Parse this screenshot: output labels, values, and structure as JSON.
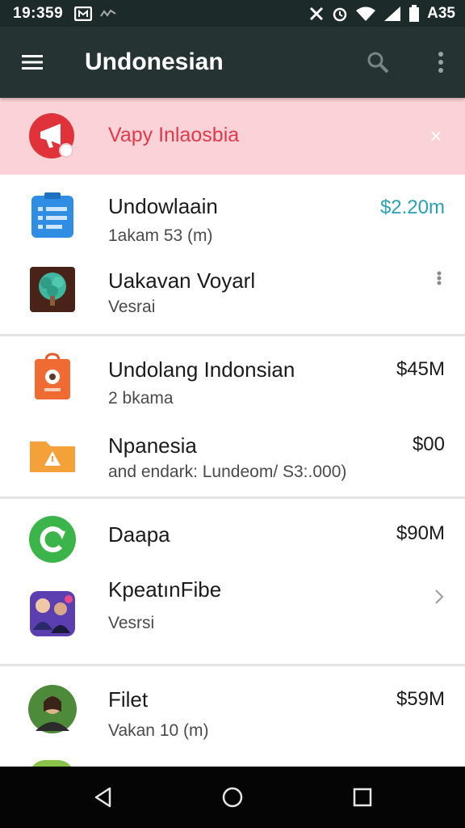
{
  "status_bar": {
    "time": "19:359",
    "battery_text": "A35"
  },
  "app_bar": {
    "title": "Undonesian"
  },
  "banner": {
    "text": "Vapy Inlaosbia",
    "close_glyph": "×"
  },
  "items": [
    {
      "title": "Undowlaain",
      "subtitle": "1akam 53 (m)",
      "amount": "$2.20m"
    },
    {
      "title": "Uakavan Voyarl",
      "subtitle": "Vesrai",
      "amount": ""
    },
    {
      "title": "Undolang Indonsian",
      "subtitle": "2 bkama",
      "amount": "$45M"
    },
    {
      "title": "Npanesia",
      "subtitle": "and endark: Lundeom/ S3:.000)",
      "amount": "$00"
    },
    {
      "title": "Daapa",
      "subtitle": "",
      "amount": "$90M"
    },
    {
      "title": "KpeatınFibe",
      "subtitle": "Vesrsi",
      "amount": ""
    },
    {
      "title": "Filet",
      "subtitle": "Vakan 10 (m)",
      "amount": "$59M"
    }
  ],
  "colors": {
    "status_bar": "#1d2a2a",
    "app_bar": "#263333",
    "banner_bg": "#fbd2d7",
    "banner_text": "#e03a4a",
    "amount_accent": "#2aa0b5",
    "nav_bar": "#050505"
  },
  "icons": {
    "menu": "hamburger-icon",
    "search": "search-icon",
    "more": "more-vert-icon",
    "banner": "megaphone-icon",
    "close": "close-icon"
  }
}
